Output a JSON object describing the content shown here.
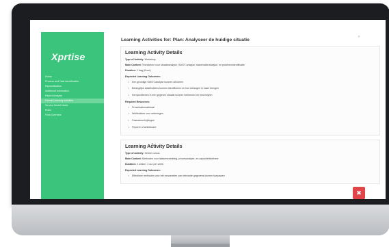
{
  "app": {
    "logo": "Xprtise"
  },
  "sidebar": {
    "items": [
      {
        "label": "Home"
      },
      {
        "label": "Process and Task Identification"
      },
      {
        "label": "Reprioritization"
      },
      {
        "label": "Additional Information"
      },
      {
        "label": "Report Analysis"
      },
      {
        "label": "Formal Learning Activities"
      },
      {
        "label": "Service Model Matrix"
      },
      {
        "label": "Plans"
      },
      {
        "label": "Final Overview"
      }
    ],
    "active_index": 5
  },
  "main": {
    "heading": "Learning Activities for: Plan: Analyseer de huidige situatie",
    "collapse_glyph": "›",
    "cards": [
      {
        "title": "Learning Activity Details",
        "type_label": "Type of Activity:",
        "type_value": "Workshop",
        "content_label": "Main Content:",
        "content_value": "Technieken voor situatieanalyse, SWOT-analyse, stakeholderanalyse, en probleemidentificatie",
        "duration_label": "Duration:",
        "duration_value": "1 dag (8 uur)",
        "outcomes_label": "Expected Learning Outcomes:",
        "outcomes": [
          "Een grondige SWOT-analyse kunnen uitvoeren",
          "Belangrijke stakeholders kunnen identificeren en hun belangen in kaart brengen",
          "Kernproblemen in een gegeven situatie kunnen herkennen en beschrijven"
        ],
        "resources_label": "Required Resources:",
        "resources": [
          "Presentatiemateriaal",
          "Werkbladen voor oefeningen",
          "Casusbeschrijvingen",
          "Flipover of whiteboard"
        ]
      },
      {
        "title": "Learning Activity Details",
        "type_label": "Type of Activity:",
        "type_value": "Online cursus",
        "content_label": "Main Content:",
        "content_value": "Methoden voor dataverzameling, procesanalyse, en capaciteitsbeheer",
        "duration_label": "Duration:",
        "duration_value": "2 weken, 4 uur per week",
        "outcomes_label": "Expected Learning Outcomes:",
        "outcomes": [
          "Effectieve methoden voor het verzamelen van relevante gegevens kunnen toepassen"
        ]
      }
    ]
  },
  "fab": {
    "glyph": "✖"
  },
  "colors": {
    "accent": "#3bc47b",
    "active_nav": "#6fd69c",
    "fab": "#e0454a"
  }
}
